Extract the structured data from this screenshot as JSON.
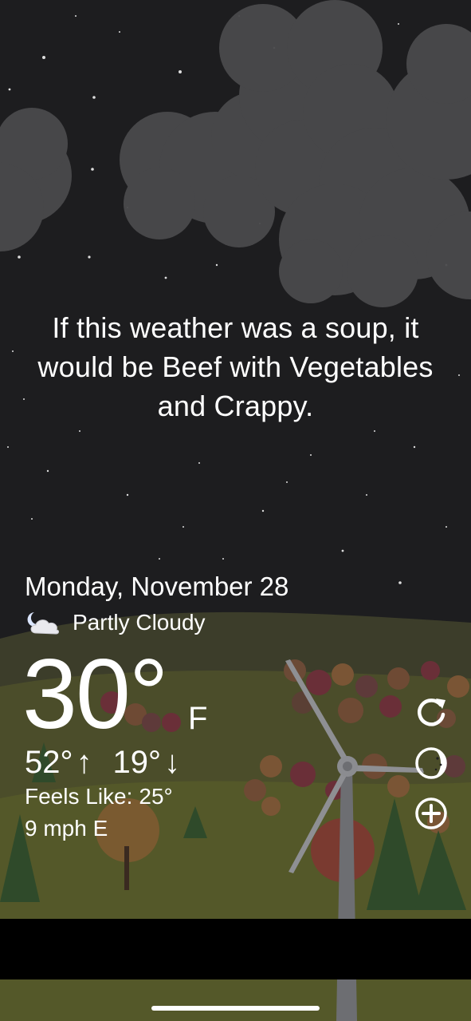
{
  "quote": {
    "text": "If this weather was a soup, it would be Beef with Vegetables and Crappy."
  },
  "date": "Monday, November 28",
  "condition": {
    "icon": "partly-cloudy-night-icon",
    "text": "Partly Cloudy"
  },
  "temperature": {
    "value": "30°",
    "unit": "F"
  },
  "high_low": {
    "high": "52°",
    "high_arrow": "↑",
    "low": "19°",
    "low_arrow": "↓"
  },
  "feels_like": {
    "label": "Feels Like:",
    "value": "25°"
  },
  "wind": "9 mph E",
  "actions": {
    "refresh_icon": "refresh-icon",
    "theme_icon": "moon-theme-icon",
    "add_icon": "add-location-icon"
  },
  "colors": {
    "sky": "#1d1d1f",
    "cloud": "#4a4a4c",
    "ground": "#4b4d2a",
    "text": "#ffffff"
  }
}
